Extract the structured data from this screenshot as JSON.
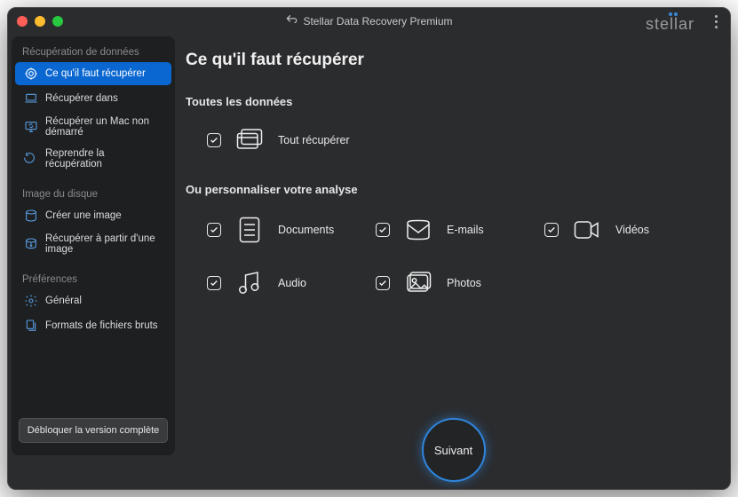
{
  "app_title": "Stellar Data Recovery Premium",
  "brand": {
    "pre": "ste",
    "post": "ar"
  },
  "sidebar": {
    "group_recovery": {
      "header": "Récupération de données",
      "items": [
        {
          "label": "Ce qu'il faut récupérer",
          "active": true
        },
        {
          "label": "Récupérer dans"
        },
        {
          "label": "Récupérer un Mac non démarré"
        },
        {
          "label": "Reprendre la récupération"
        }
      ]
    },
    "group_image": {
      "header": "Image du disque",
      "items": [
        {
          "label": "Créer une image"
        },
        {
          "label": "Récupérer à partir d'une image"
        }
      ]
    },
    "group_prefs": {
      "header": "Préférences",
      "items": [
        {
          "label": "Général"
        },
        {
          "label": "Formats de fichiers bruts"
        }
      ]
    },
    "unlock": "Débloquer la version complète"
  },
  "page": {
    "title": "Ce qu'il faut récupérer",
    "all_heading": "Toutes les données",
    "all_option": "Tout récupérer",
    "customize_heading": "Ou personnaliser votre analyse",
    "options": {
      "documents": "Documents",
      "emails": "E-mails",
      "videos": "Vidéos",
      "audio": "Audio",
      "photos": "Photos"
    },
    "next": "Suivant"
  }
}
